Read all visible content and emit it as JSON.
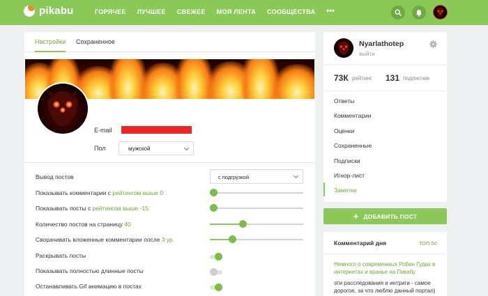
{
  "brand": {
    "name": "pikabu",
    "accent": "#8ac858",
    "link_color": "#6aa935"
  },
  "nav": {
    "items": [
      "ГОРЯЧЕЕ",
      "ЛУЧШЕЕ",
      "СВЕЖЕЕ",
      "МОЯ ЛЕНТА",
      "СООБЩЕСТВА"
    ],
    "more": "•••"
  },
  "header_icons": [
    "search-icon",
    "bell-icon",
    "user-avatar"
  ],
  "settings": {
    "tabs": [
      {
        "label": "Настройки",
        "active": true
      },
      {
        "label": "Сохраненное",
        "active": false
      }
    ],
    "email_label": "E-mail",
    "email_value_redacted": true,
    "sex_label": "Пол",
    "sex_value": "мужской",
    "rows": [
      {
        "label": "Вывод постов",
        "control": "select",
        "value": "с подгрузкой"
      },
      {
        "label_prefix": "Показывать комментарии с ",
        "label_highlight": "рейтингом выше 0",
        "control": "slider",
        "level": 0.04
      },
      {
        "label_prefix": "Показывать посты с ",
        "label_highlight": "рейтингом выше -15",
        "control": "slider",
        "level": 0.04
      },
      {
        "label_prefix": "Количество постов на страницу ",
        "label_highlight": "40",
        "control": "slider",
        "level": 0.35
      },
      {
        "label_prefix": "Сворачивать вложенные комментарии после ",
        "label_highlight": "3 ур.",
        "control": "slider",
        "level": 0.24
      },
      {
        "label": "Раскрывать посты",
        "control": "toggle",
        "on": true
      },
      {
        "label": "Показывать полностью длинные посты",
        "control": "toggle",
        "on": false
      },
      {
        "label": "Останавливать Gif анимацию в постах",
        "control": "toggle",
        "on": true
      }
    ]
  },
  "profile": {
    "username": "Nyarlathotep",
    "logout": "выйти",
    "rating_value": "73К",
    "rating_label": "рейтинг",
    "subscribers_value": "131",
    "subscribers_label": "подписчик",
    "menu": [
      "Ответы",
      "Комментарии",
      "Оценки",
      "Сохраненные",
      "Подписки",
      "Игнор-лист",
      "Заметки"
    ],
    "active_menu": "Заметки"
  },
  "add_post_button": "ДОБАВИТЬ ПОСТ",
  "comment_of_day": {
    "title": "Комментарий дня",
    "top_link": "ТОП 50",
    "post_link": "Немного о современных Робин Гудах в интернетах и вранье на Пикабу",
    "text": "эти расследования и интриги - самое дорогое, за что люблю данный портал)"
  }
}
